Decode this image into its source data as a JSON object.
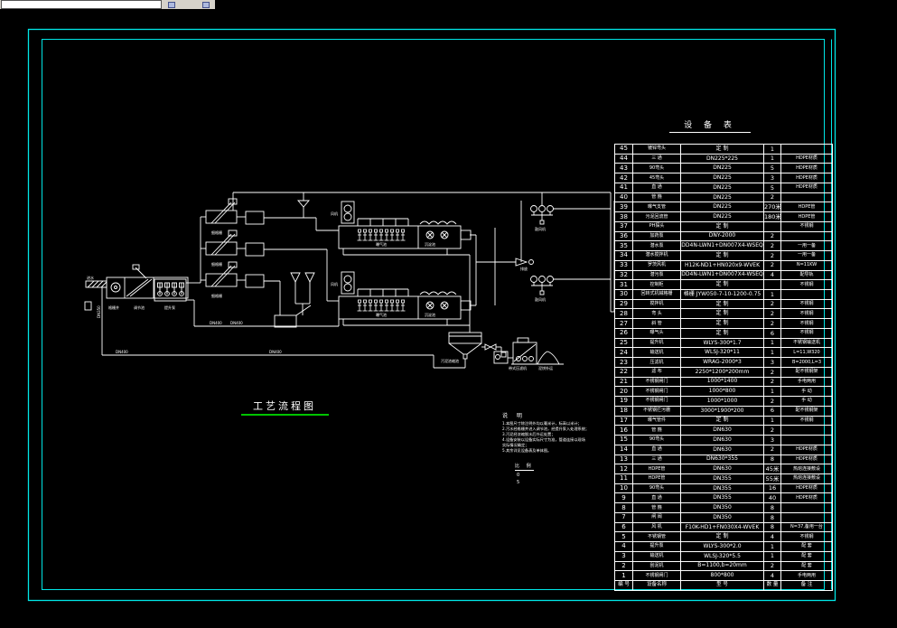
{
  "toolbar": {
    "command_value": "",
    "buttons": [
      "tool-icon-1",
      "tool-icon-2"
    ]
  },
  "drawing": {
    "title": "工艺流程图",
    "table_title": "设 备 表",
    "notes": {
      "heading": "说  明",
      "lines": [
        "1.本图尺寸除注明外均以毫米计，标高以米计；",
        "2.污水经格栅井进入调节池，经提升泵入处理系统；",
        "3.污泥经浓缩脱水后外运处置；",
        "4.设备安装以设备实际尺寸为准，管道连接以现场",
        "  实际情况确定；",
        "5.其余详见设备表及单体图。"
      ]
    },
    "scale": {
      "heading": "比 例",
      "values": [
        "0",
        "5"
      ]
    },
    "labels": {
      "inlet": "进水",
      "screen_well": "格栅井",
      "regulating": "调节池",
      "lift_pump": "提升泵",
      "fine_screen": "细格栅",
      "blower_room": "风机",
      "aeration": "曝气池",
      "settling": "沉淀池",
      "blower": "鼓风机",
      "discharge": "排放",
      "thickener": "污泥浓缩池",
      "belt_press": "带式压滤机",
      "cake": "泥饼外运",
      "dn400": "DN400",
      "dn350": "DN350"
    }
  },
  "table": {
    "header": {
      "no": "编 号",
      "name": "设备名称",
      "spec": "型   号",
      "qty": "数 量",
      "remark": "备 注"
    },
    "rows": [
      [
        "45",
        "镀锌弯头",
        "定 制",
        "1",
        ""
      ],
      [
        "44",
        "三 通",
        "DN225*225",
        "1",
        "HDPE材质"
      ],
      [
        "43",
        "90弯头",
        "DN225",
        "5",
        "HDPE材质"
      ],
      [
        "42",
        "45弯头",
        "DN225",
        "3",
        "HDPE材质"
      ],
      [
        "41",
        "直 通",
        "DN225",
        "5",
        "HDPE材质"
      ],
      [
        "40",
        "管 箍",
        "DN225",
        "2",
        ""
      ],
      [
        "39",
        "曝气支管",
        "DN225",
        "270米",
        "HDPE管"
      ],
      [
        "38",
        "污泥回流管",
        "DN225",
        "180米",
        "HDPE管"
      ],
      [
        "37",
        "PH探头",
        "定 制",
        "",
        "不锈钢"
      ],
      [
        "36",
        "加药泵",
        "DNY-2000",
        "2",
        ""
      ],
      [
        "35",
        "潜水泵",
        "DD4N-LWN1+DN007X4-WSEQ",
        "2",
        "一用一备"
      ],
      [
        "34",
        "潜水搅拌机",
        "定 制",
        "2",
        "一用一备"
      ],
      [
        "33",
        "罗茨风机",
        "H12K-ND1+HN020x9-WVEK",
        "2",
        "N=11KW"
      ],
      [
        "32",
        "潜污泵",
        "DD4N-LWN1+DN007X4-WSEQ",
        "4",
        "配导轨"
      ],
      [
        "31",
        "控制柜",
        "定 制",
        "",
        "不锈钢"
      ],
      [
        "30",
        "回转式机械格栅",
        "格栅 JYW050-7-10-1200-0.75",
        "1",
        ""
      ],
      [
        "29",
        "搅拌机",
        "定 制",
        "2",
        "不锈钢"
      ],
      [
        "28",
        "弯 头",
        "定 制",
        "2",
        "不锈钢"
      ],
      [
        "27",
        "斜 管",
        "定 制",
        "2",
        "不锈钢"
      ],
      [
        "26",
        "曝气头",
        "定 制",
        "6",
        "不锈钢"
      ],
      [
        "25",
        "提升机",
        "WLYS-300*1.7",
        "1",
        "不锈钢输送机"
      ],
      [
        "24",
        "输送机",
        "WLSJ-320*11",
        "1",
        "L=11,W320"
      ],
      [
        "23",
        "压滤机",
        "WRAG-2000*3",
        "3",
        "B=2000,L=3"
      ],
      [
        "22",
        "滤 布",
        "2250*1200*200mm",
        "2",
        "配不锈钢架"
      ],
      [
        "21",
        "不锈钢闸门",
        "1000*1400",
        "2",
        "手电两用"
      ],
      [
        "20",
        "不锈钢闸门",
        "1000*800",
        "1",
        "手 动"
      ],
      [
        "19",
        "不锈钢闸门",
        "1000*1000",
        "2",
        "手 动"
      ],
      [
        "18",
        "不锈钢拦污栅",
        "3000*1900*200",
        "6",
        "配不锈钢架"
      ],
      [
        "17",
        "曝气管件",
        "定 制",
        "1",
        "不锈钢"
      ],
      [
        "16",
        "管 箍",
        "DN630",
        "2",
        ""
      ],
      [
        "15",
        "90弯头",
        "DN630",
        "3",
        ""
      ],
      [
        "14",
        "直 通",
        "DN630",
        "2",
        "HDPE材质"
      ],
      [
        "13",
        "三 通",
        "DN630*355",
        "8",
        "HDPE材质"
      ],
      [
        "12",
        "HDPE管",
        "DN630",
        "45米",
        "热熔连接敷设"
      ],
      [
        "11",
        "HDPE管",
        "DN355",
        "55米",
        "热熔连接敷设"
      ],
      [
        "10",
        "90弯头",
        "DN355",
        "16",
        "HDPE材质"
      ],
      [
        "9",
        "直 通",
        "DN355",
        "40",
        "HDPE材质"
      ],
      [
        "8",
        "管 箍",
        "DN350",
        "8",
        ""
      ],
      [
        "7",
        "闸 阀",
        "DN350",
        "8",
        ""
      ],
      [
        "6",
        "风 机",
        "F10K-HD1+FN030X4-WVEK",
        "8",
        "N=37,备用一台"
      ],
      [
        "5",
        "不锈钢管",
        "定 制",
        "4",
        "不锈钢"
      ],
      [
        "4",
        "提升泵",
        "WLYS-300*2.0",
        "1",
        "配 套"
      ],
      [
        "3",
        "输送机",
        "WLSJ-320*5.5",
        "1",
        "配 套"
      ],
      [
        "2",
        "刮泥机",
        "B=1100,b=20mm",
        "2",
        "配 套"
      ],
      [
        "1",
        "不锈钢闸门",
        "800*800",
        "4",
        "手电两用"
      ]
    ]
  },
  "colors": {
    "background": "#000000",
    "line": "#ffffff",
    "frame": "#00e6e6",
    "title_underline": "#00c400",
    "toolbar_bg": "#d6d2ca"
  }
}
